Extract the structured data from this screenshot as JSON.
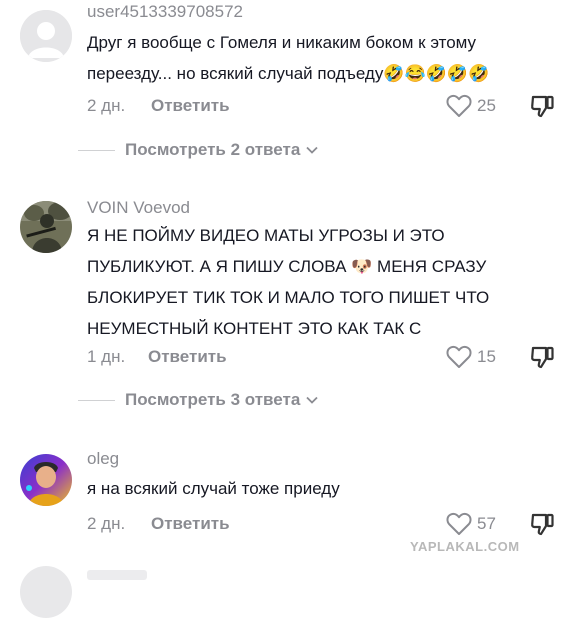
{
  "comments": [
    {
      "username": "user4513339708572",
      "text": "Друг я вообще с Гомеля и никаким боком к этому переезду... но всякий случай подъеду🤣😂🤣🤣🤣",
      "time": "2 дн.",
      "reply_label": "Ответить",
      "likes": "25",
      "view_replies": "Посмотреть 2 ответа",
      "avatar": "default-avatar"
    },
    {
      "username": "VOIN Voevod",
      "text": "Я НЕ ПОЙМУ ВИДЕО МАТЫ УГРОЗЫ И ЭТО ПУБЛИКУЮТ. А Я ПИШУ СЛОВА 🐶 МЕНЯ СРАЗУ БЛОКИРУЕТ ТИК ТОК И МАЛО ТОГО ПИШЕТ ЧТО НЕУМЕСТНЫЙ КОНТЕНТ ЭТО КАК ТАК С",
      "time": "1 дн.",
      "reply_label": "Ответить",
      "likes": "15",
      "view_replies": "Посмотреть 3 ответа",
      "avatar": "soldier-photo-avatar"
    },
    {
      "username": "oleg",
      "text": "я на всякий случай тоже приеду",
      "time": "2 дн.",
      "reply_label": "Ответить",
      "likes": "57",
      "avatar": "colorful-person-avatar"
    }
  ],
  "watermark": "YAPLAKAL.COM",
  "icons": {
    "like": "heart-outline-icon",
    "dislike": "thumbs-down-icon",
    "expand": "chevron-down-icon"
  },
  "colors": {
    "text": "#161823",
    "muted": "#8a8b91",
    "divider": "#d0d1d3"
  }
}
